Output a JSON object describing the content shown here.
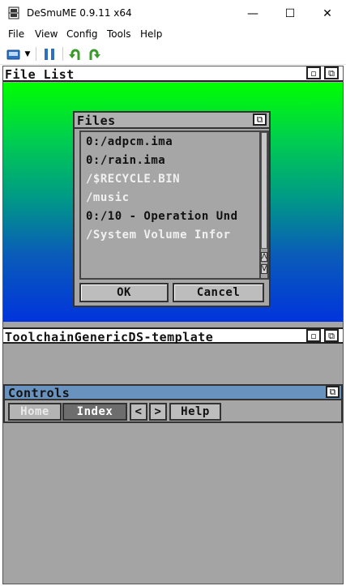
{
  "window": {
    "title": "DeSmuME 0.9.11 x64",
    "minimize": "—",
    "maximize": "☐",
    "close": "✕"
  },
  "menu": [
    "File",
    "View",
    "Config",
    "Tools",
    "Help"
  ],
  "toolbar": {
    "icons": [
      "open-rom-icon",
      "dropdown-arrow-icon",
      "pause-icon",
      "rotate-left-icon",
      "rotate-right-icon"
    ]
  },
  "top_screen": {
    "title": "File List",
    "files_dialog": {
      "title": "Files",
      "items": [
        {
          "text": "0:/adpcm.ima",
          "color": "#111111"
        },
        {
          "text": "0:/rain.ima",
          "color": "#111111"
        },
        {
          "text": "/$RECYCLE.BIN",
          "color": "#f0f0f0"
        },
        {
          "text": "/music",
          "color": "#f0f0f0"
        },
        {
          "text": "0:/10 - Operation Und",
          "color": "#111111"
        },
        {
          "text": "/System Volume Infor",
          "color": "#f0f0f0"
        }
      ],
      "scroll_up": "Λ",
      "scroll_down": "V",
      "ok": "OK",
      "cancel": "Cancel"
    }
  },
  "bottom_screen": {
    "title": "ToolchainGenericDS-template",
    "controls": {
      "title": "Controls",
      "buttons": [
        "Home",
        "Index",
        "<",
        ">",
        "Help"
      ]
    }
  },
  "colors": {
    "gradient_top": "#00ff00",
    "gradient_bottom": "#0034dc",
    "controls_header": "#6a92be",
    "ds_background": "#a4a4a4"
  }
}
